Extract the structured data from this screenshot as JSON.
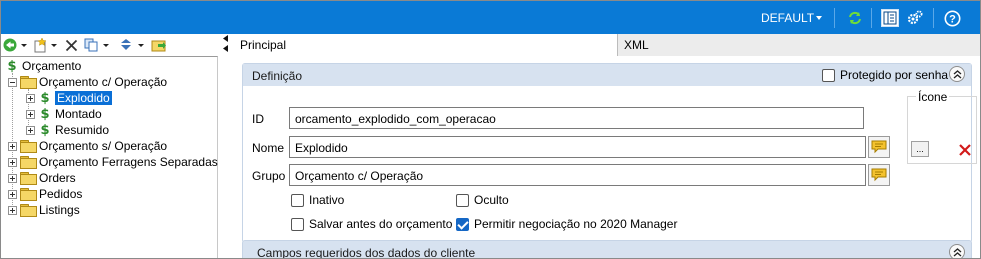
{
  "topbar": {
    "profile_label": "DEFAULT",
    "icons": [
      "refresh-icon",
      "layout-icon",
      "gears-icon",
      "help-icon"
    ]
  },
  "toolbar": {
    "icons": [
      "back-icon",
      "new-item-icon",
      "delete-icon",
      "copy-icon",
      "move-icon",
      "export-icon"
    ]
  },
  "tree": {
    "root": "Orçamento",
    "items": [
      {
        "label": "Orçamento c/ Operação",
        "expanded": true
      },
      {
        "label": "Explodido",
        "selected": true
      },
      {
        "label": "Montado"
      },
      {
        "label": "Resumido"
      },
      {
        "label": "Orçamento s/ Operação"
      },
      {
        "label": "Orçamento Ferragens Separadas"
      },
      {
        "label": "Orders"
      },
      {
        "label": "Pedidos"
      },
      {
        "label": "Listings"
      }
    ]
  },
  "tabs": [
    {
      "label": "Principal",
      "active": true
    },
    {
      "label": "XML",
      "active": false
    }
  ],
  "definicao": {
    "title": "Definição",
    "protected_label": "Protegido por senha",
    "protected_checked": false,
    "icon_group_label": "Ícone",
    "icon_button_label": "...",
    "fields": {
      "id_label": "ID",
      "id_value": "orcamento_explodido_com_operacao",
      "nome_label": "Nome",
      "nome_value": "Explodido",
      "grupo_label": "Grupo",
      "grupo_value": "Orçamento c/ Operação"
    },
    "checkboxes": {
      "inativo": {
        "label": "Inativo",
        "checked": false
      },
      "oculto": {
        "label": "Oculto",
        "checked": false
      },
      "salvar": {
        "label": "Salvar antes do orçamento",
        "checked": false
      },
      "permitir": {
        "label": "Permitir negociação no 2020 Manager",
        "checked": true
      }
    }
  },
  "campos": {
    "title": "Campos requeridos dos dados do cliente"
  },
  "colors": {
    "topbar": "#0a7ad6",
    "selection": "#0a6fd6",
    "panel_header": "#d7e2f0",
    "checkbox_checked": "#1567c5"
  }
}
